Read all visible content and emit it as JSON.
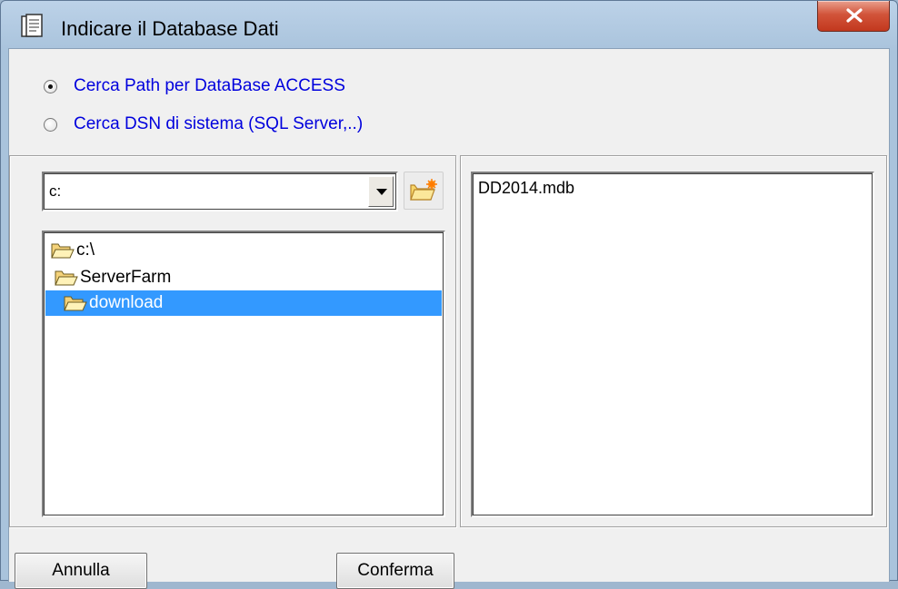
{
  "window": {
    "title": "Indicare il Database Dati"
  },
  "options": {
    "access": {
      "label": "Cerca Path per DataBase ACCESS",
      "checked": true
    },
    "dsn": {
      "label": "Cerca DSN di sistema (SQL Server,..)",
      "checked": false
    }
  },
  "drive": {
    "value": "c:"
  },
  "tree": {
    "items": [
      {
        "label": "c:\\"
      },
      {
        "label": "ServerFarm"
      },
      {
        "label": "download",
        "selected": true
      }
    ]
  },
  "files": {
    "items": [
      {
        "label": "DD2014.mdb"
      }
    ]
  },
  "buttons": {
    "cancel": "Annulla",
    "confirm": "Conferma"
  },
  "colors": {
    "selection": "#3399ff",
    "radio_label": "#0000dd",
    "close_button": "#c2381e"
  }
}
